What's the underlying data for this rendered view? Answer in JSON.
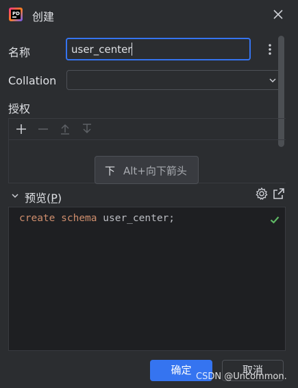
{
  "window": {
    "title": "创建",
    "app_icon": "jetbrains-ide-icon",
    "close_icon": "close-icon"
  },
  "form": {
    "name_label": "名称",
    "name_value": "user_center",
    "collation_label": "Collation",
    "collation_value": "",
    "grants_label": "授权"
  },
  "grants_toolbar": {
    "icons": [
      "plus-icon",
      "minus-icon",
      "move-up-icon",
      "move-down-icon"
    ]
  },
  "tooltip": {
    "key": "下",
    "shortcut": "Alt+向下箭头"
  },
  "preview": {
    "label": "预览(P)",
    "mnemonic_char": "P",
    "code": {
      "kw1": "create",
      "kw2": "schema",
      "identifier": "user_center;"
    },
    "status_icon": "checkmark-icon"
  },
  "buttons": {
    "ok": "确定",
    "cancel": "取消"
  },
  "watermark": "CSDN @Uncommon.",
  "colors": {
    "accent": "#3574f0",
    "background": "#2b2d30",
    "editor_background": "#1e1f22",
    "keyword": "#cf8e6d",
    "success": "#5fb865"
  }
}
